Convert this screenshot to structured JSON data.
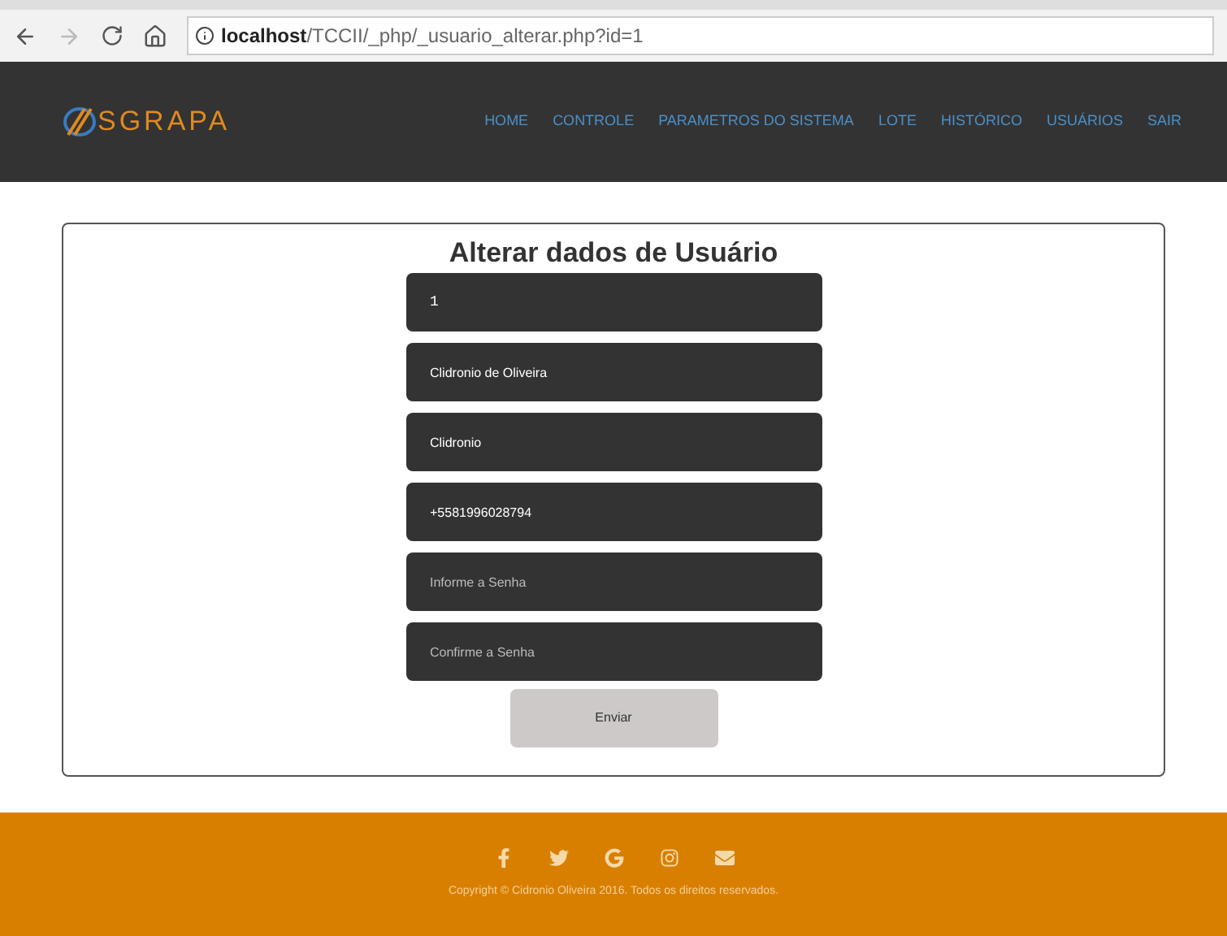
{
  "browser": {
    "url": "**localhost**/TCCII/_php/_usuario_alterar.php?id=1"
  },
  "header": {
    "logo": "SGRAPA",
    "nav": [
      "HOME",
      "CONTROLE",
      "PARAMETROS DO SISTEMA",
      "LOTE",
      "HISTÓRICO",
      "USUÁRIOS",
      "SAIR"
    ]
  },
  "form": {
    "title": "Alterar dados de Usuário",
    "fields": [
      {
        "value": "1",
        "kind": "readonly"
      },
      {
        "value": "Clidronio de Oliveira",
        "kind": "text"
      },
      {
        "value": "Clidronio",
        "kind": "text"
      },
      {
        "value": "+5581996028794",
        "kind": "text"
      },
      {
        "placeholder": "Informe a Senha",
        "kind": "password"
      },
      {
        "placeholder": "Confirme a Senha",
        "kind": "password"
      }
    ],
    "submit": "Enviar"
  },
  "footer": {
    "social": [
      {
        "kind": "facebook"
      },
      {
        "kind": "twitter"
      },
      {
        "kind": "google"
      },
      {
        "kind": "instagram"
      },
      {
        "kind": "email"
      }
    ],
    "copyright": "Copyright © Cidronio Oliveira 2016. Todos os direitos reservados."
  }
}
